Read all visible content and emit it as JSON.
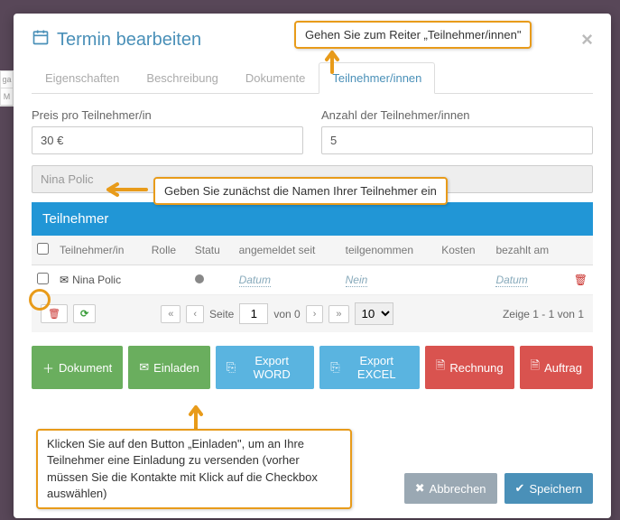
{
  "modal": {
    "title": "Termin bearbeiten"
  },
  "callouts": {
    "c1": "Gehen Sie zum Reiter „Teilnehmer/innen\"",
    "c2": "Geben Sie zunächst die Namen Ihrer Teilnehmer ein",
    "c3": "Klicken Sie auf den Button „Einladen\", um an Ihre Teilnehmer eine Einladung zu versenden (vorher müssen Sie die Kontakte mit Klick auf die Checkbox auswählen)"
  },
  "tabs": {
    "t0": "Eigenschaften",
    "t1": "Beschreibung",
    "t2": "Dokumente",
    "t3": "Teilnehmer/innen"
  },
  "form": {
    "price_label": "Preis pro Teilnehmer/in",
    "price_value": "30 €",
    "count_label": "Anzahl der Teilnehmer/innen",
    "count_value": "5",
    "name_value": "Nina Polic"
  },
  "panel": {
    "header": "Teilnehmer"
  },
  "table": {
    "headers": {
      "h1": "Teilnehmer/in",
      "h2": "Rolle",
      "h3": "Statu",
      "h4": "angemeldet seit",
      "h5": "teilgenommen",
      "h6": "Kosten",
      "h7": "bezahlt am"
    },
    "row1": {
      "name": "Nina Polic",
      "angemeldet": "Datum",
      "teilgenommen": "Nein",
      "bezahlt": "Datum"
    }
  },
  "pager": {
    "seite": "Seite",
    "page": "1",
    "von": "von 0",
    "pagesize": "10",
    "info": "Zeige 1 - 1 von 1"
  },
  "actions": {
    "dokument": "Dokument",
    "einladen": "Einladen",
    "export_word": "Export WORD",
    "export_excel": "Export EXCEL",
    "rechnung": "Rechnung",
    "auftrag": "Auftrag"
  },
  "footer": {
    "cancel": "Abbrechen",
    "save": "Speichern"
  },
  "sidebar_frag": {
    "a": "ga",
    "b": "M"
  }
}
